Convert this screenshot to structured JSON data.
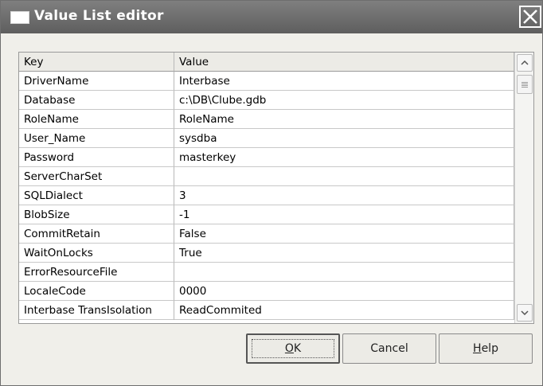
{
  "window": {
    "title": "Value List editor"
  },
  "grid": {
    "headers": {
      "key": "Key",
      "value": "Value"
    },
    "rows": [
      {
        "key": "DriverName",
        "value": "Interbase"
      },
      {
        "key": "Database",
        "value": "c:\\DB\\Clube.gdb"
      },
      {
        "key": "RoleName",
        "value": "RoleName"
      },
      {
        "key": "User_Name",
        "value": "sysdba"
      },
      {
        "key": "Password",
        "value": "masterkey"
      },
      {
        "key": "ServerCharSet",
        "value": ""
      },
      {
        "key": "SQLDialect",
        "value": "3"
      },
      {
        "key": "BlobSize",
        "value": "-1"
      },
      {
        "key": "CommitRetain",
        "value": "False"
      },
      {
        "key": "WaitOnLocks",
        "value": "True"
      },
      {
        "key": "ErrorResourceFile",
        "value": ""
      },
      {
        "key": "LocaleCode",
        "value": "0000"
      },
      {
        "key": "Interbase TransIsolation",
        "value": "ReadCommited"
      }
    ]
  },
  "buttons": {
    "ok": {
      "mnemonic": "O",
      "rest": "K"
    },
    "cancel": {
      "label": "Cancel"
    },
    "help": {
      "mnemonic": "H",
      "rest": "elp"
    }
  },
  "icons": {
    "close": "close-icon",
    "scroll_up": "chevron-up-icon",
    "scroll_down": "chevron-down-icon"
  }
}
